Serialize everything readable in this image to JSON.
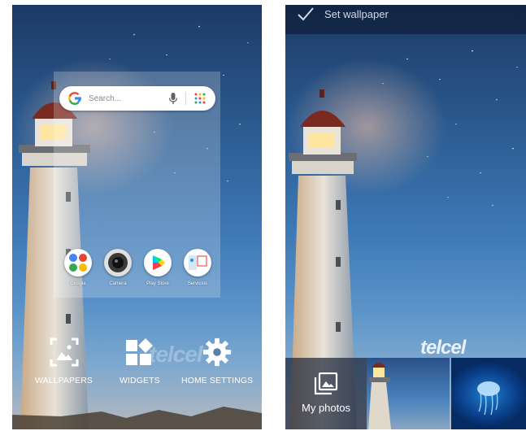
{
  "home_edit": {
    "search_placeholder": "Search...",
    "apps": [
      {
        "label": "Google",
        "icon": "google-folder-icon"
      },
      {
        "label": "Camera",
        "icon": "camera-icon"
      },
      {
        "label": "Play Store",
        "icon": "play-store-icon"
      },
      {
        "label": "Servicios",
        "icon": "servicios-icon"
      }
    ],
    "watermark": "telcel",
    "actions": [
      {
        "label": "WALLPAPERS",
        "icon": "wallpapers-icon"
      },
      {
        "label": "WIDGETS",
        "icon": "widgets-icon"
      },
      {
        "label": "HOME SETTINGS",
        "icon": "gear-icon"
      }
    ]
  },
  "wallpaper_picker": {
    "title": "Set wallpaper",
    "watermark": "telcel",
    "my_photos_label": "My photos",
    "thumbnails": [
      "lighthouse-thumbnail",
      "jellyfish-thumbnail"
    ]
  },
  "colors": {
    "sky_top": "#1d3a66",
    "sky_bottom": "#7ea8cf",
    "search_bar": "#ffffff",
    "topbar": "#0a1428"
  }
}
